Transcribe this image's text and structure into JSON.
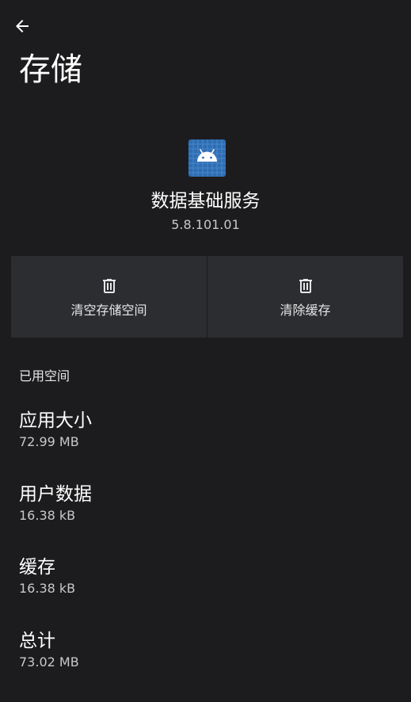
{
  "header": {
    "back_icon": "arrow-back-icon",
    "title": "存储"
  },
  "app": {
    "icon": "android-app-icon",
    "icon_color": "#2f6db3",
    "name": "数据基础服务",
    "version": "5.8.101.01"
  },
  "actions": [
    {
      "icon": "trash-icon",
      "label": "清空存储空间"
    },
    {
      "icon": "trash-icon",
      "label": "清除缓存"
    }
  ],
  "storage": {
    "section_title": "已用空间",
    "rows": [
      {
        "label": "应用大小",
        "value": "72.99 MB"
      },
      {
        "label": "用户数据",
        "value": "16.38 kB"
      },
      {
        "label": "缓存",
        "value": "16.38 kB"
      },
      {
        "label": "总计",
        "value": "73.02 MB"
      }
    ]
  },
  "colors": {
    "background": "#1c1c1e",
    "card": "#2c2d31",
    "primary_text": "#ffffff",
    "secondary_text": "#c8c8c8"
  }
}
